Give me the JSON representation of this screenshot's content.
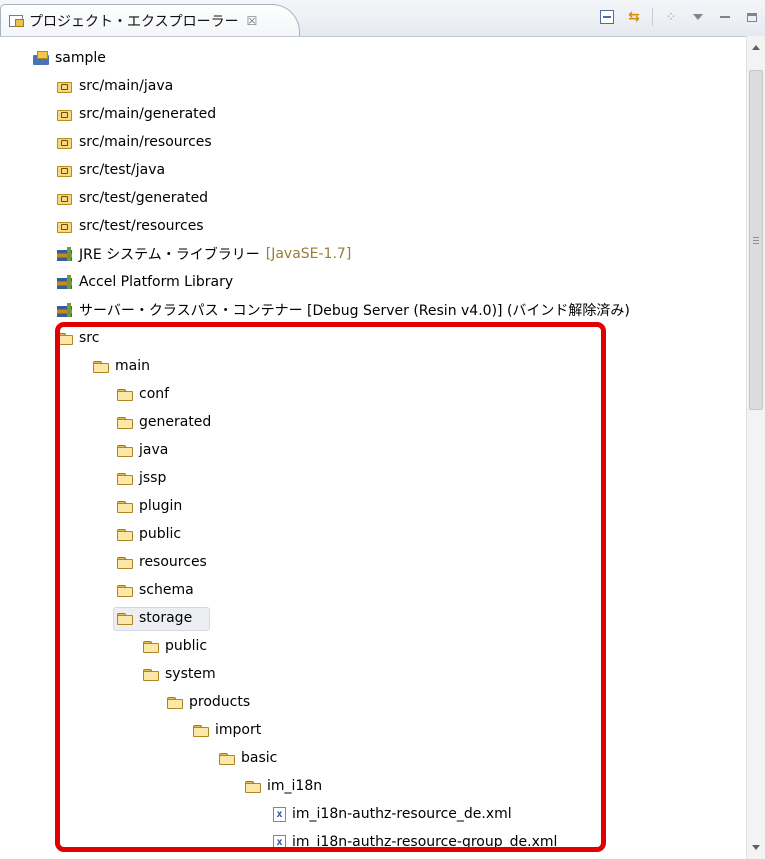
{
  "view": {
    "tab_title": "プロジェクト・エクスプローラー",
    "close_glyph": "☒"
  },
  "toolbar": {
    "icons": [
      "collapse-all-icon",
      "link-with-editor-icon",
      "filters-icon",
      "view-menu-icon",
      "minimize-icon",
      "maximize-icon"
    ]
  },
  "tree": [
    {
      "label": "sample",
      "icon": "project",
      "indent": 0
    },
    {
      "label": "src/main/java",
      "icon": "srcpkg",
      "indent": 1
    },
    {
      "label": "src/main/generated",
      "icon": "srcpkg",
      "indent": 1
    },
    {
      "label": "src/main/resources",
      "icon": "srcpkg",
      "indent": 1
    },
    {
      "label": "src/test/java",
      "icon": "srcpkg",
      "indent": 1
    },
    {
      "label": "src/test/generated",
      "icon": "srcpkg",
      "indent": 1
    },
    {
      "label": "src/test/resources",
      "icon": "srcpkg",
      "indent": 1
    },
    {
      "label": "JRE システム・ライブラリー",
      "deco": "[JavaSE-1.7]",
      "icon": "library",
      "indent": 1
    },
    {
      "label": "Accel Platform Library",
      "icon": "library",
      "indent": 1
    },
    {
      "label": "サーバー・クラスパス・コンテナー [Debug Server (Resin v4.0)] (バインド解除済み)",
      "icon": "library",
      "indent": 1
    },
    {
      "label": "src",
      "icon": "folder",
      "indent": 1
    },
    {
      "label": "main",
      "icon": "folder",
      "indent": 2
    },
    {
      "label": "conf",
      "icon": "folder",
      "indent": 3
    },
    {
      "label": "generated",
      "icon": "folder",
      "indent": 3
    },
    {
      "label": "java",
      "icon": "folder",
      "indent": 3
    },
    {
      "label": "jssp",
      "icon": "folder",
      "indent": 3
    },
    {
      "label": "plugin",
      "icon": "folder",
      "indent": 3
    },
    {
      "label": "public",
      "icon": "folder",
      "indent": 3
    },
    {
      "label": "resources",
      "icon": "folder",
      "indent": 3
    },
    {
      "label": "schema",
      "icon": "folder",
      "indent": 3
    },
    {
      "label": "storage",
      "icon": "folder",
      "indent": 3,
      "selected": true
    },
    {
      "label": "public",
      "icon": "folder",
      "indent": 4
    },
    {
      "label": "system",
      "icon": "folder",
      "indent": 4
    },
    {
      "label": "products",
      "icon": "folder",
      "indent": 5
    },
    {
      "label": "import",
      "icon": "folder",
      "indent": 6
    },
    {
      "label": "basic",
      "icon": "folder",
      "indent": 7
    },
    {
      "label": "im_i18n",
      "icon": "folder",
      "indent": 8
    },
    {
      "label": "im_i18n-authz-resource_de.xml",
      "icon": "xml",
      "indent": 9
    },
    {
      "label": "im_i18n-authz-resource-group_de.xml",
      "icon": "xml",
      "indent": 9
    }
  ],
  "xml_glyph": "x",
  "colors": {
    "highlight": "#e00000",
    "decoration": "#9b7d3a"
  }
}
